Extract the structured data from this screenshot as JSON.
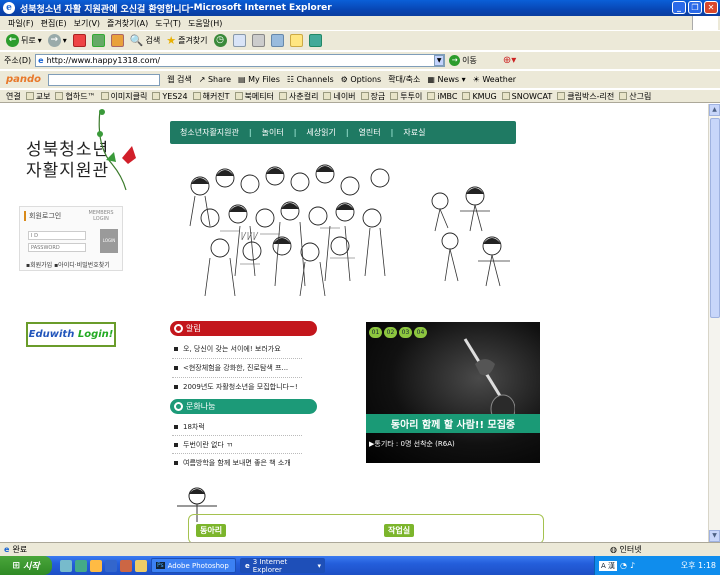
{
  "window": {
    "title_doc": "성북청소년 자활 지원관에 오신걸 환영합니다",
    "title_sep": " - ",
    "title_app": "Microsoft Internet Explorer"
  },
  "menu": [
    "파일(F)",
    "편집(E)",
    "보기(V)",
    "즐겨찾기(A)",
    "도구(T)",
    "도움말(H)"
  ],
  "toolbar": {
    "back": "뒤로",
    "search": "검색",
    "favorites": "즐겨찾기"
  },
  "address": {
    "label": "주소(D)",
    "url": "http://www.happy1318.com/",
    "go": "이동"
  },
  "pando": {
    "brand": "pando",
    "web_search": "웹 검색",
    "share": "Share",
    "myfiles": "My Files",
    "channels": "Channels",
    "options": "Options",
    "zoom": "확대/축소",
    "news": "News",
    "weather": "Weather"
  },
  "links": {
    "label": "연결",
    "items": [
      "교보",
      "협하드™",
      "이미지클릭",
      "YES24",
      "해커진T",
      "북메티터",
      "사춘컬리",
      "네이버",
      "장금",
      "투투이",
      "iMBC",
      "KMUG",
      "SNOWCAT",
      "클립박스-리전",
      "산그림"
    ]
  },
  "site": {
    "logo_line1": "성북청소년",
    "logo_line2": "자활지원관",
    "nav": [
      "청소년자활지원관",
      "놀이터",
      "세상읽기",
      "열린터",
      "자료실"
    ],
    "login": {
      "title": "회원로그인",
      "members": "MEMBERS LOGIN",
      "id_ph": "I D",
      "pw_ph": "PASSWORD",
      "btn": "LOGIN",
      "join": "회원가입",
      "find": "아이디·비밀번호찾기"
    },
    "edu_a": "Eduwith",
    "edu_b": "Login!",
    "notice": {
      "title": "알림",
      "items": [
        "오, 당신이 갖는 서이에! 보러가요",
        "<현장체험을 강화한, 진로탐색 프...",
        "2009년도 자활청소년을 모집합니다~!"
      ]
    },
    "culture": {
      "title": "문화나눔",
      "items": [
        "18차럭",
        "두번이란 없다 ㄲ",
        "여름방학을 함께 보내면 좋은 책 소개"
      ]
    },
    "feature": {
      "tabs": [
        "01",
        "02",
        "03",
        "04"
      ],
      "headline": "동아리 함께 할 사람!! 모집중",
      "sub": "▶통기타 : 0명 선착순 (R6A)"
    },
    "bottom_tags": [
      "동아리",
      "작업실"
    ]
  },
  "status": {
    "text": "완료",
    "zone": "인터넷"
  },
  "taskbar": {
    "start": "시작",
    "tasks": [
      "Adobe Photoshop",
      "3 Internet Explorer"
    ],
    "clock": "오후 1:18",
    "ime": "A 漢"
  }
}
